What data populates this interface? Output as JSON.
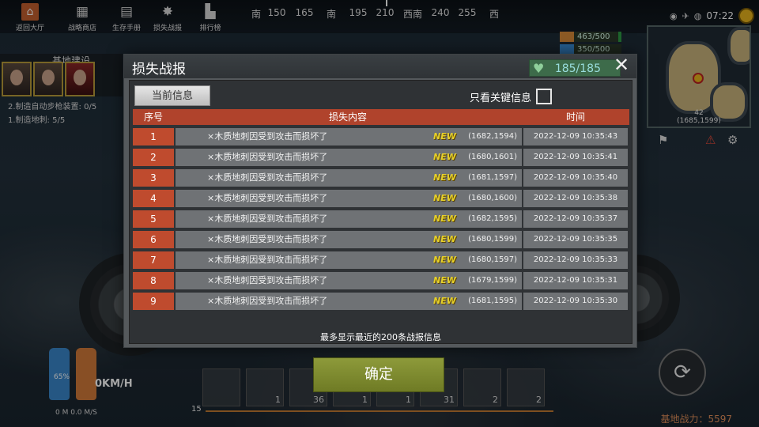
{
  "topbar": {
    "buttons": [
      {
        "label": "返回大厅",
        "icon": "home-icon"
      },
      {
        "label": "战略商店",
        "icon": "shop-icon"
      },
      {
        "label": "生存手册",
        "icon": "book-icon"
      },
      {
        "label": "损失战报",
        "icon": "damage-report-icon"
      },
      {
        "label": "排行榜",
        "icon": "podium-icon"
      }
    ],
    "compass": [
      "南",
      "150",
      "165",
      "南",
      "195",
      "210",
      "西南",
      "240",
      "255",
      "西"
    ],
    "time": "07:22"
  },
  "resources": {
    "food": "463/500",
    "water": "350/500"
  },
  "minimap": {
    "level": "42",
    "coords": "(1685,1599)"
  },
  "quest": {
    "title": "基地建设",
    "lines": [
      "2.制造自动步枪装置: 0/5",
      "1.制造地刺: 5/5"
    ]
  },
  "modal": {
    "title": "损失战报",
    "hp": "185/185",
    "tab_current": "当前信息",
    "key_only_label": "只看关键信息",
    "headers": {
      "no": "序号",
      "content": "损失内容",
      "time": "时间"
    },
    "new_badge": "NEW",
    "rows": [
      {
        "no": "1",
        "content": "×木质地刺因受到攻击而损坏了",
        "pos": "(1682,1594)",
        "time": "2022-12-09 10:35:43"
      },
      {
        "no": "2",
        "content": "×木质地刺因受到攻击而损坏了",
        "pos": "(1680,1601)",
        "time": "2022-12-09 10:35:41"
      },
      {
        "no": "3",
        "content": "×木质地刺因受到攻击而损坏了",
        "pos": "(1681,1597)",
        "time": "2022-12-09 10:35:40"
      },
      {
        "no": "4",
        "content": "×木质地刺因受到攻击而损坏了",
        "pos": "(1680,1600)",
        "time": "2022-12-09 10:35:38"
      },
      {
        "no": "5",
        "content": "×木质地刺因受到攻击而损坏了",
        "pos": "(1682,1595)",
        "time": "2022-12-09 10:35:37"
      },
      {
        "no": "6",
        "content": "×木质地刺因受到攻击而损坏了",
        "pos": "(1680,1599)",
        "time": "2022-12-09 10:35:35"
      },
      {
        "no": "7",
        "content": "×木质地刺因受到攻击而损坏了",
        "pos": "(1680,1597)",
        "time": "2022-12-09 10:35:33"
      },
      {
        "no": "8",
        "content": "×木质地刺因受到攻击而损坏了",
        "pos": "(1679,1599)",
        "time": "2022-12-09 10:35:31"
      },
      {
        "no": "9",
        "content": "×木质地刺因受到攻击而损坏了",
        "pos": "(1681,1595)",
        "time": "2022-12-09 10:35:30"
      }
    ],
    "footnote": "最多显示最近的200条战报信息",
    "confirm_label": "确定"
  },
  "hud": {
    "speed": "0KM/H",
    "speed_sub": "0 M 0.0 M/S",
    "level": "15",
    "tank_percent": "65%",
    "slots": [
      "",
      "1",
      "36",
      "1",
      "1",
      "31",
      "2",
      "2",
      ""
    ],
    "base_power": "基地战力：5597"
  }
}
